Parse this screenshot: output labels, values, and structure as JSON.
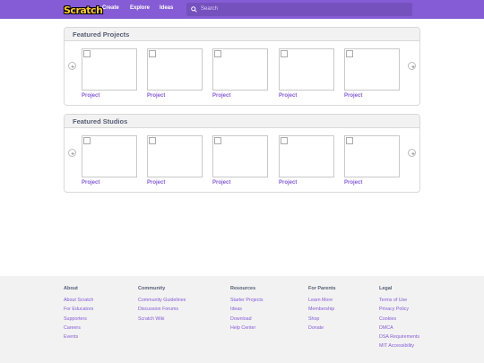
{
  "nav": {
    "logo_text": "Scratch",
    "links": [
      "Create",
      "Explore",
      "Ideas"
    ],
    "search_placeholder": "Search"
  },
  "colors": {
    "brand": "#855cd6",
    "link": "#855cd6",
    "header_text": "#575e75"
  },
  "sections": [
    {
      "title": "Featured Projects",
      "items": [
        "Project",
        "Project",
        "Project",
        "Project",
        "Project"
      ]
    },
    {
      "title": "Featured Studios",
      "items": [
        "Project",
        "Project",
        "Project",
        "Project",
        "Project"
      ]
    }
  ],
  "footer": {
    "columns": [
      {
        "title": "About",
        "links": [
          "About Scratch",
          "For Educators",
          "Supporters",
          "Careers",
          "Events"
        ]
      },
      {
        "title": "Community",
        "links": [
          "Community Guidelines",
          "Discussion Forums",
          "Scratch Wiki"
        ]
      },
      {
        "title": "Resources",
        "links": [
          "Starter Projects",
          "Ideas",
          "Download",
          "Help Center"
        ]
      },
      {
        "title": "For Parents",
        "links": [
          "Learn More",
          "Membership",
          "Shop",
          "Donate"
        ]
      },
      {
        "title": "Legal",
        "links": [
          "Terms of Use",
          "Privacy Policy",
          "Cookies",
          "DMCA",
          "DSA Requirements",
          "MIT Accessibility"
        ]
      }
    ]
  },
  "icons": [
    "scratch-logo",
    "search-icon",
    "arrow-left-icon",
    "arrow-right-icon",
    "broken-image-icon"
  ]
}
